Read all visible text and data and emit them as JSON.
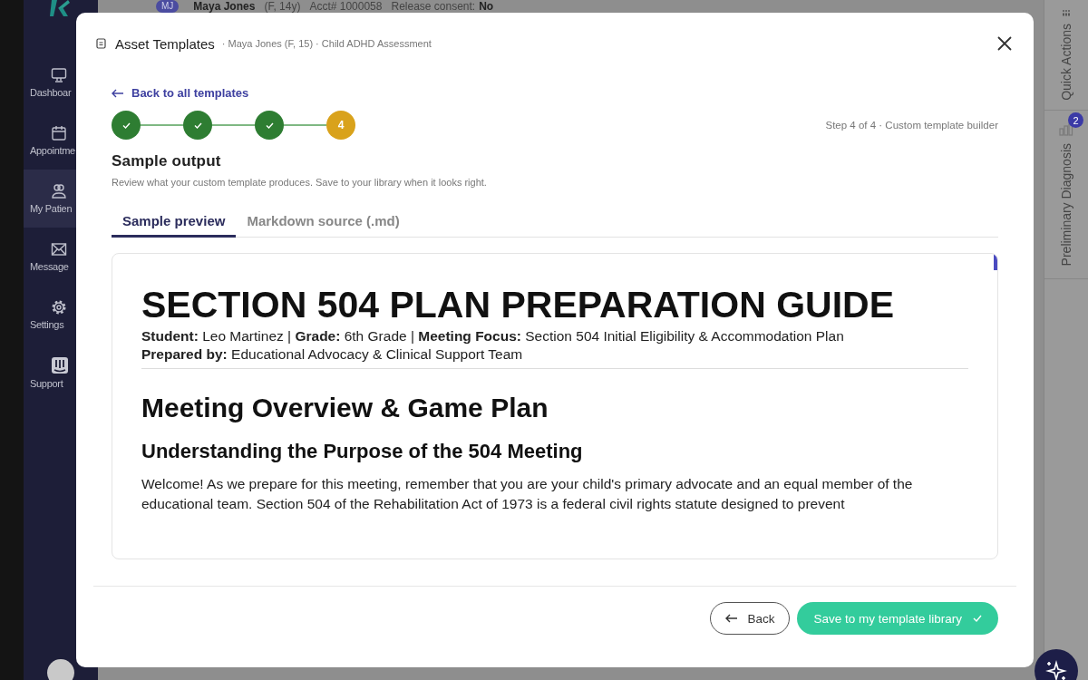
{
  "top_bar": {
    "avatar_initials": "MJ",
    "patient_name": "Maya Jones",
    "patient_info": "(F, 14y)",
    "account": "Acct# 1000058",
    "consent_label": "Release consent:",
    "consent_value": "No"
  },
  "sidebar": {
    "items": [
      {
        "label": "Dashboar",
        "kind": "monitor",
        "selected": false
      },
      {
        "label": "Appointme",
        "kind": "calendar",
        "selected": false
      },
      {
        "label": "My Patien",
        "kind": "people",
        "selected": true
      },
      {
        "label": "Message",
        "kind": "envelope",
        "selected": false
      },
      {
        "label": "Settings",
        "kind": "gear",
        "selected": false
      },
      {
        "label": "Support",
        "kind": "bars",
        "selected": false
      }
    ]
  },
  "right_panel": {
    "tabs": [
      {
        "label": "Quick Actions",
        "kind": "menu"
      },
      {
        "label": "Preliminary Diagnosis",
        "kind": "chart",
        "badge": "2"
      }
    ]
  },
  "modal": {
    "title": "Asset Templates",
    "subtitle": "· Maya Jones (F, 15) · Child ADHD Assessment",
    "back_link": "Back to all templates",
    "steps": [
      {
        "completed": true
      },
      {
        "completed": true
      },
      {
        "completed": true
      },
      {
        "completed": false,
        "label": "4"
      }
    ],
    "step_caption": "Step 4 of 4 · Custom template builder",
    "section_title": "Sample output",
    "section_description": "Review what your custom template produces. Save to your library when it looks right.",
    "tabs": [
      {
        "label": "Sample preview",
        "selected": true
      },
      {
        "label": "Markdown source (.md)",
        "selected": false
      }
    ],
    "document": {
      "title": "SECTION 504 PLAN PREPARATION GUIDE",
      "meta": [
        "**Student:** Leo Martinez | **Grade:** 6th Grade | **Meeting Focus:** Section 504 Initial Eligibility & Accommodation Plan",
        "**Prepared by:** Educational Advocacy & Clinical Support Team"
      ],
      "heading": "Meeting Overview & Game Plan",
      "subheading": "Understanding the Purpose of the 504 Meeting",
      "paragraph": "Welcome! As we prepare for this meeting, remember that you are your child's primary advocate and an equal member of the educational team. Section 504 of the Rehabilitation Act of 1973 is a federal civil rights statute designed to prevent"
    },
    "buttons": {
      "back": "Back",
      "save": "Save to my template library"
    }
  }
}
